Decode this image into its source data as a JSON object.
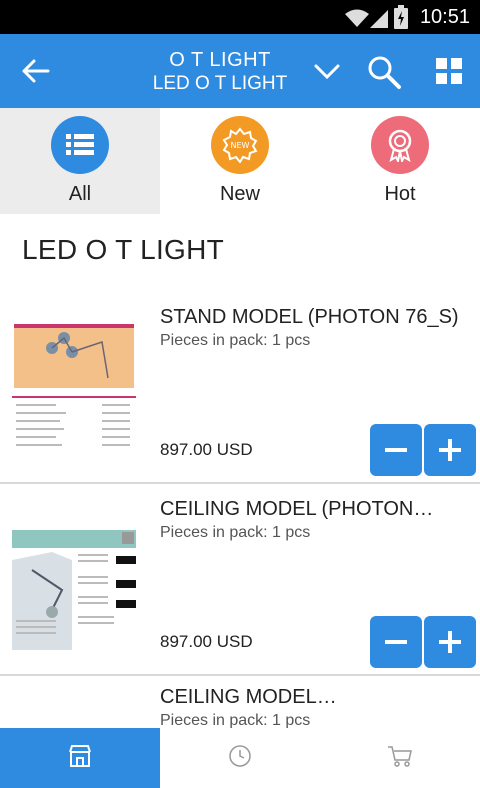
{
  "status_bar": {
    "time": "10:51",
    "wifi_icon": "wifi-icon",
    "signal_icon": "signal-icon",
    "battery_icon": "battery-charging-icon"
  },
  "app_bar": {
    "title": "O T LIGHT",
    "subtitle": "LED O T LIGHT",
    "icons": [
      "back-arrow-icon",
      "chevron-down-icon",
      "search-icon",
      "grid-view-icon"
    ],
    "color": "#2f8be0"
  },
  "categories": [
    {
      "label": "All",
      "icon": "list-icon",
      "color": "#2f8be0",
      "active": true
    },
    {
      "label": "New",
      "icon": "new-badge-icon",
      "color": "#f39a25",
      "active": false
    },
    {
      "label": "Hot",
      "icon": "award-icon",
      "color": "#ee6b7a",
      "active": false
    }
  ],
  "section_title": "LED O T LIGHT",
  "products": [
    {
      "name": "STAND MODEL (PHOTON 76_S)",
      "pack": "Pieces in pack: 1 pcs",
      "price": "897.00 USD"
    },
    {
      "name": "CEILING MODEL (PHOTON…",
      "pack": "Pieces in pack: 1 pcs",
      "price": "897.00 USD"
    },
    {
      "name": "CEILING MODEL…",
      "pack": "Pieces in pack: 1 pcs"
    }
  ],
  "bottom_nav": [
    {
      "icon": "store-icon",
      "active": true
    },
    {
      "icon": "clock-icon",
      "active": false
    },
    {
      "icon": "cart-icon",
      "active": false
    }
  ]
}
